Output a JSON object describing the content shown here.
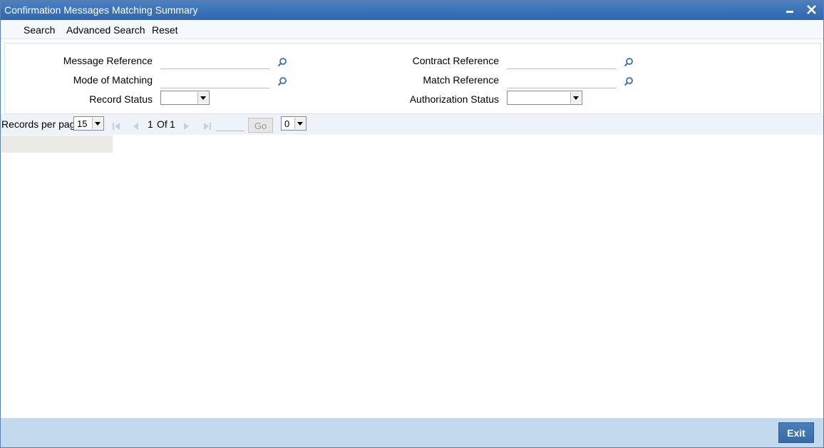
{
  "window": {
    "title": "Confirmation Messages Matching Summary",
    "minimize_icon": "minimize-icon",
    "close_icon": "close-icon"
  },
  "toolbar": {
    "search_label": "Search",
    "advanced_search_label": "Advanced Search",
    "reset_label": "Reset"
  },
  "criteria": {
    "message_reference": {
      "label": "Message Reference",
      "value": "",
      "icon": "search-icon"
    },
    "mode_of_matching": {
      "label": "Mode of Matching",
      "value": "",
      "icon": "search-icon"
    },
    "record_status": {
      "label": "Record Status",
      "value": ""
    },
    "contract_reference": {
      "label": "Contract Reference",
      "value": "",
      "icon": "search-icon"
    },
    "match_reference": {
      "label": "Match Reference",
      "value": "",
      "icon": "search-icon"
    },
    "authorization_status": {
      "label": "Authorization Status",
      "value": ""
    }
  },
  "pager": {
    "records_per_page_label": "Records per page",
    "records_per_page_value": "15",
    "current_page": "1",
    "of_label": "Of",
    "total_pages": "1",
    "go_label": "Go",
    "extra_select_value": "0"
  },
  "footer": {
    "exit_label": "Exit"
  },
  "colors": {
    "titlebar": "#3a72b8",
    "footer": "#c2d9ee",
    "exit_button": "#4377b2"
  }
}
